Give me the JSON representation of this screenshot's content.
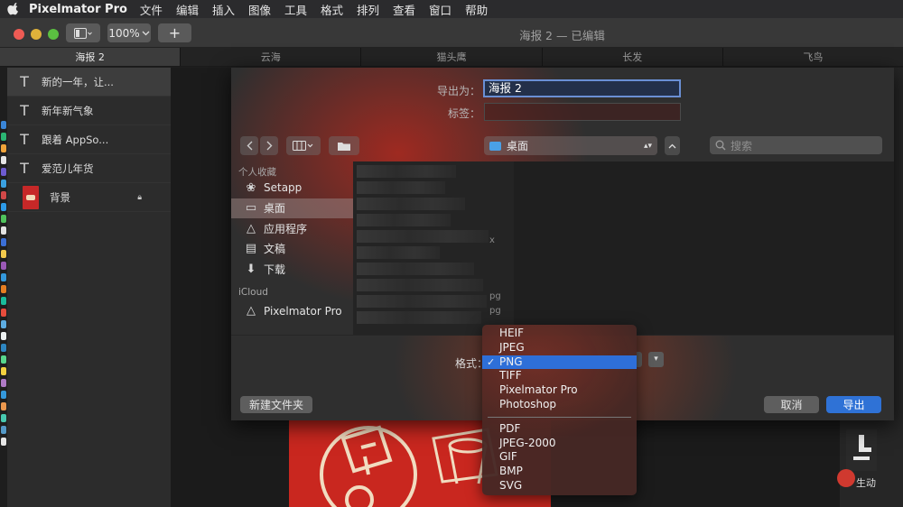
{
  "menubar": {
    "app": "Pixelmator Pro",
    "items": [
      "文件",
      "编辑",
      "插入",
      "图像",
      "工具",
      "格式",
      "排列",
      "查看",
      "窗口",
      "帮助"
    ]
  },
  "titlebar": {
    "zoom": "100%",
    "add": "+",
    "title": "海报 2 — 已编辑"
  },
  "tabs": [
    "海报 2",
    "云海",
    "猫头鹰",
    "长发",
    "飞鸟"
  ],
  "layers": [
    {
      "label": "新的一年，让...",
      "type": "text"
    },
    {
      "label": "新年新气象",
      "type": "text"
    },
    {
      "label": "跟着 AppSo...",
      "type": "text"
    },
    {
      "label": "爱范儿年货",
      "type": "text"
    },
    {
      "label": "背景",
      "type": "image"
    }
  ],
  "export": {
    "save_as_label": "导出为：",
    "save_as_value": "海报 2",
    "tags_label": "标签：",
    "location": "桌面",
    "search_placeholder": "搜索",
    "sidebar": {
      "favorites_head": "个人收藏",
      "favorites": [
        "Setapp",
        "桌面",
        "应用程序",
        "文稿",
        "下载"
      ],
      "icloud_head": "iCloud",
      "icloud": [
        "Pixelmator Pro"
      ]
    },
    "file_ext": [
      "x",
      "pg",
      "pg"
    ],
    "format_label": "格式：",
    "new_folder": "新建文件夹",
    "cancel": "取消",
    "export": "导出"
  },
  "format_menu": {
    "group1": [
      "HEIF",
      "JPEG",
      "PNG",
      "TIFF",
      "Pixelmator Pro",
      "Photoshop"
    ],
    "group2": [
      "PDF",
      "JPEG-2000",
      "GIF",
      "BMP",
      "SVG"
    ],
    "selected": "PNG"
  },
  "right_panel": {
    "label": "生动"
  },
  "colors": {
    "accent": "#2e6fd8",
    "poster_red": "#c9271f"
  }
}
